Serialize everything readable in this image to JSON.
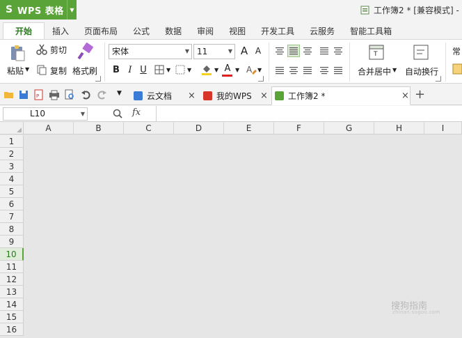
{
  "app": {
    "logo": "S",
    "name": "WPS 表格",
    "document_title": "工作簿2 * [兼容模式] -"
  },
  "ribbon_tabs": [
    {
      "label": "开始",
      "active": true
    },
    {
      "label": "插入"
    },
    {
      "label": "页面布局"
    },
    {
      "label": "公式"
    },
    {
      "label": "数据"
    },
    {
      "label": "审阅"
    },
    {
      "label": "视图"
    },
    {
      "label": "开发工具"
    },
    {
      "label": "云服务"
    },
    {
      "label": "智能工具箱"
    }
  ],
  "ribbon": {
    "paste_label": "粘贴",
    "cut_label": "剪切",
    "copy_label": "复制",
    "format_painter_label": "格式刷",
    "font_name": "宋体",
    "font_size": "11",
    "merge_center_label": "合并居中",
    "wrap_text_label": "自动换行",
    "style_partial": "常",
    "bold": "B",
    "italic": "I",
    "underline": "U",
    "font_color_letter": "A",
    "font_color": "#e02020",
    "grow_font": "A",
    "shrink_font": "A"
  },
  "doc_tabs": [
    {
      "label": "云文档",
      "icon": "cube-icon"
    },
    {
      "label": "我的WPS",
      "icon": "wps-logo-icon"
    },
    {
      "label": "工作簿2 *",
      "icon": "sheet-icon",
      "active": true
    }
  ],
  "new_tab_label": "+",
  "close_glyph": "×",
  "formula_bar": {
    "name_box": "L10",
    "fx_label": "fx",
    "value": ""
  },
  "columns": [
    "A",
    "B",
    "C",
    "D",
    "E",
    "F",
    "G",
    "H",
    "I"
  ],
  "rows": [
    "1",
    "2",
    "3",
    "4",
    "5",
    "6",
    "7",
    "8",
    "9",
    "10",
    "11",
    "12",
    "13",
    "14",
    "15",
    "16"
  ],
  "selected_row": "10",
  "watermark": {
    "text": "搜狗指南",
    "sub": "zhinan.sogou.com"
  },
  "colors": {
    "brand_green": "#5aa338",
    "active_tab_text": "#2a7a1f"
  }
}
